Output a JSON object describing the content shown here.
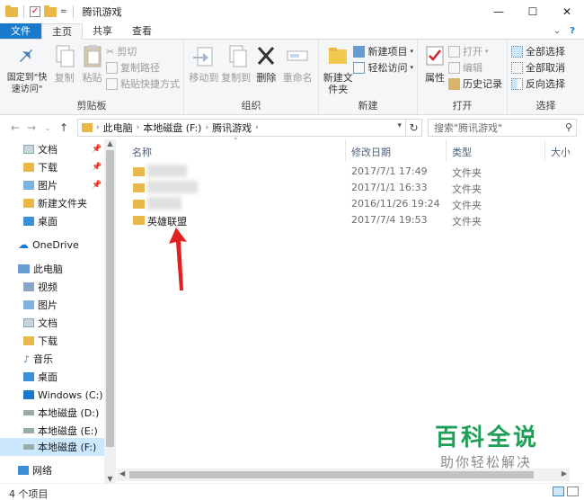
{
  "window": {
    "title": "腾讯游戏",
    "controls": [
      "minimize",
      "maximize",
      "close"
    ]
  },
  "quick_access_toolbar": {
    "dropdown_glyph": "="
  },
  "ribbon_tabs": [
    {
      "label": "文件",
      "kind": "file"
    },
    {
      "label": "主页",
      "kind": "active"
    },
    {
      "label": "共享",
      "kind": "normal"
    },
    {
      "label": "查看",
      "kind": "normal"
    }
  ],
  "ribbon": {
    "clipboard": {
      "group_label": "剪贴板",
      "pin_label": "固定到\"快速访问\"",
      "copy_label": "复制",
      "paste_label": "粘贴",
      "cut_label": "剪切",
      "copy_path_label": "复制路径",
      "paste_shortcut_label": "粘贴快捷方式"
    },
    "organize": {
      "group_label": "组织",
      "move_to_label": "移动到",
      "copy_to_label": "复制到",
      "delete_label": "删除",
      "rename_label": "重命名"
    },
    "new": {
      "group_label": "新建",
      "new_folder_label": "新建文件夹",
      "new_item_label": "新建项目",
      "easy_access_label": "轻松访问"
    },
    "open": {
      "group_label": "打开",
      "properties_label": "属性",
      "open_label": "打开",
      "edit_label": "编辑",
      "history_label": "历史记录"
    },
    "select": {
      "group_label": "选择",
      "select_all_label": "全部选择",
      "select_none_label": "全部取消",
      "invert_label": "反向选择"
    }
  },
  "address_bar": {
    "crumbs": [
      "此电脑",
      "本地磁盘 (F:)",
      "腾讯游戏"
    ]
  },
  "search": {
    "placeholder": "搜索\"腾讯游戏\""
  },
  "nav_pane": {
    "quick_access": [
      {
        "label": "文档",
        "pinned": true
      },
      {
        "label": "下载",
        "pinned": true
      },
      {
        "label": "图片",
        "pinned": true
      },
      {
        "label": "新建文件夹",
        "pinned": false
      },
      {
        "label": "桌面",
        "pinned": false
      }
    ],
    "onedrive": "OneDrive",
    "this_pc": "此电脑",
    "pc_items": [
      "视频",
      "图片",
      "文档",
      "下载",
      "音乐",
      "桌面"
    ],
    "drives": [
      "Windows (C:)",
      "本地磁盘 (D:)",
      "本地磁盘 (E:)",
      "本地磁盘 (F:)"
    ],
    "network": "网络"
  },
  "file_list": {
    "columns": {
      "name": "名称",
      "modified": "修改日期",
      "type": "类型",
      "size": "大小"
    },
    "rows": [
      {
        "name": "",
        "modified": "2017/7/1 17:49",
        "type": "文件夹",
        "blurred": true
      },
      {
        "name": "",
        "modified": "2017/1/1 16:33",
        "type": "文件夹",
        "blurred": true
      },
      {
        "name": "",
        "modified": "2016/11/26 19:24",
        "type": "文件夹",
        "blurred": true
      },
      {
        "name": "英雄联盟",
        "modified": "2017/7/4 19:53",
        "type": "文件夹",
        "blurred": false
      }
    ]
  },
  "status_bar": {
    "item_count": "4 个项目"
  },
  "watermark": {
    "title": "百科全说",
    "subtitle": "助你轻松解决"
  },
  "colors": {
    "file_tab": "#1979ca",
    "folder": "#e8b84a",
    "annotation_arrow": "#e02020",
    "watermark_green": "#1f9e55",
    "selection": "#cce8ff"
  }
}
